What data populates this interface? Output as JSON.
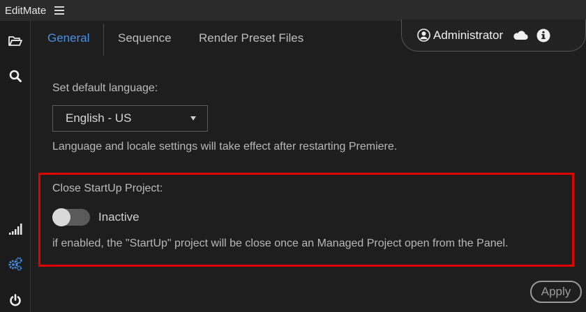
{
  "app": {
    "name": "EditMate"
  },
  "tabs": [
    {
      "label": "General",
      "active": true
    },
    {
      "label": "Sequence",
      "active": false
    },
    {
      "label": "Render Preset Files",
      "active": false
    }
  ],
  "user": {
    "name": "Administrator"
  },
  "settings": {
    "language_label": "Set default language:",
    "language_value": "English - US",
    "language_help": "Language and locale settings will take effect after restarting Premiere.",
    "startup_label": "Close StartUp Project:",
    "startup_toggle_state": "Inactive",
    "startup_enabled": false,
    "startup_help": "if enabled, the \"StartUp\" project will be close once an Managed Project open from the Panel."
  },
  "buttons": {
    "apply": "Apply"
  },
  "colors": {
    "accent": "#4a90e2",
    "highlight": "#e00000",
    "settings_icon": "#4a90e2"
  },
  "icons": {
    "sidebar": [
      "folder-open-icon",
      "search-icon",
      "signal-icon",
      "settings-cogs-icon",
      "power-icon"
    ],
    "header": [
      "user-circle-icon",
      "cloud-icon",
      "info-icon"
    ]
  }
}
